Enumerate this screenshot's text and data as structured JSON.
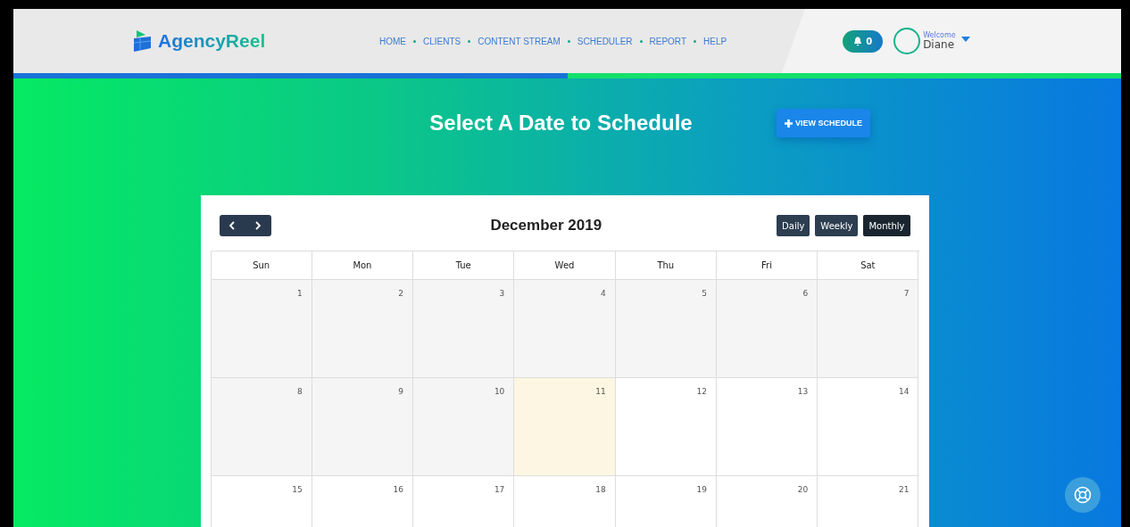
{
  "header": {
    "logo": "AgencyReel",
    "nav": [
      "HOME",
      "CLIENTS",
      "CONTENT STREAM",
      "SCHEDULER",
      "REPORT",
      "HELP"
    ],
    "notifications": "0",
    "welcome": "Welcome",
    "user": "Diane"
  },
  "progress": {
    "level": 0.5
  },
  "page": {
    "title": "Select A Date to Schedule",
    "action": "VIEW SCHEDULE"
  },
  "calendar": {
    "title": "December 2019",
    "views": [
      {
        "label": "Daily",
        "selected": false
      },
      {
        "label": "Weekly",
        "selected": false
      },
      {
        "label": "Monthly",
        "selected": true
      }
    ],
    "weekdays": [
      "Sun",
      "Mon",
      "Tue",
      "Wed",
      "Thu",
      "Fri",
      "Sat"
    ],
    "weeks": [
      [
        {
          "day": "1",
          "kind": "past"
        },
        {
          "day": "2",
          "kind": "past"
        },
        {
          "day": "3",
          "kind": "past"
        },
        {
          "day": "4",
          "kind": "past"
        },
        {
          "day": "5",
          "kind": "past"
        },
        {
          "day": "6",
          "kind": "past"
        },
        {
          "day": "7",
          "kind": "past"
        }
      ],
      [
        {
          "day": "8",
          "kind": "past"
        },
        {
          "day": "9",
          "kind": "past"
        },
        {
          "day": "10",
          "kind": "past"
        },
        {
          "day": "11",
          "kind": "today"
        },
        {
          "day": "12",
          "kind": "future"
        },
        {
          "day": "13",
          "kind": "future"
        },
        {
          "day": "14",
          "kind": "future"
        }
      ],
      [
        {
          "day": "15",
          "kind": "future"
        },
        {
          "day": "16",
          "kind": "future"
        },
        {
          "day": "17",
          "kind": "future"
        },
        {
          "day": "18",
          "kind": "future"
        },
        {
          "day": "19",
          "kind": "future"
        },
        {
          "day": "20",
          "kind": "future"
        },
        {
          "day": "21",
          "kind": "future"
        }
      ]
    ]
  }
}
